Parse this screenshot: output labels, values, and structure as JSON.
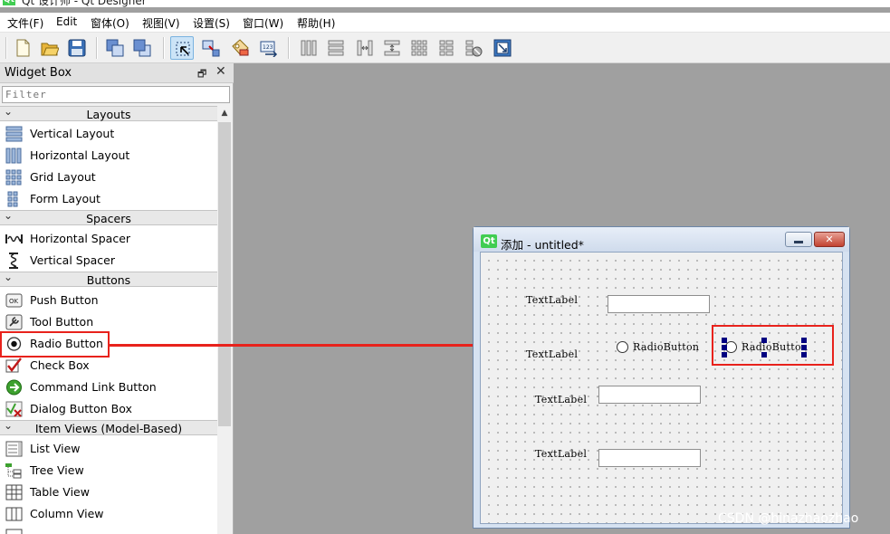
{
  "app": {
    "icon_text": "Qt",
    "window_title": "Qt 设计师 - Qt Designer"
  },
  "menu": [
    "文件(F)",
    "Edit",
    "窗体(O)",
    "视图(V)",
    "设置(S)",
    "窗口(W)",
    "帮助(H)"
  ],
  "toolbar_icons": [
    "new-form-icon",
    "open-form-icon",
    "save-form-icon",
    "send-to-back-icon",
    "bring-to-front-icon",
    "edit-widgets-icon",
    "edit-signals-slots-icon",
    "edit-buddies-icon",
    "edit-tab-order-icon",
    "lay-out-horizontally-icon",
    "lay-out-vertically-icon",
    "lay-out-horizontal-splitter-icon",
    "lay-out-vertical-splitter-icon",
    "lay-out-grid-icon",
    "lay-out-form-icon",
    "break-layout-icon",
    "adjust-size-icon"
  ],
  "widget_box": {
    "title": "Widget Box",
    "float_glyph": "🗗",
    "close_glyph": "✕",
    "filter_placeholder": "Filter",
    "categories": [
      {
        "label": "Layouts",
        "items": [
          "Vertical Layout",
          "Horizontal Layout",
          "Grid Layout",
          "Form Layout"
        ]
      },
      {
        "label": "Spacers",
        "items": [
          "Horizontal Spacer",
          "Vertical Spacer"
        ]
      },
      {
        "label": "Buttons",
        "items": [
          "Push Button",
          "Tool Button",
          "Radio Button",
          "Check Box",
          "Command Link Button",
          "Dialog Button Box"
        ]
      },
      {
        "label": "Item Views (Model-Based)",
        "items": [
          "List View",
          "Tree View",
          "Table View",
          "Column View"
        ]
      }
    ]
  },
  "form_window": {
    "icon_text": "Qt",
    "title": "添加 - untitled*",
    "labels": [
      "TextLabel",
      "TextLabel",
      "TextLabel",
      "TextLabel"
    ],
    "radio_buttons": [
      "RadioButton",
      "RadioButton"
    ],
    "minimize_glyph": "—",
    "close_glyph": "✕"
  },
  "colors": {
    "annotation_red": "#e8221c",
    "qt_green": "#41cd52",
    "selection_handle": "#000080"
  },
  "watermark": "CSDN @hinazhaozhao"
}
